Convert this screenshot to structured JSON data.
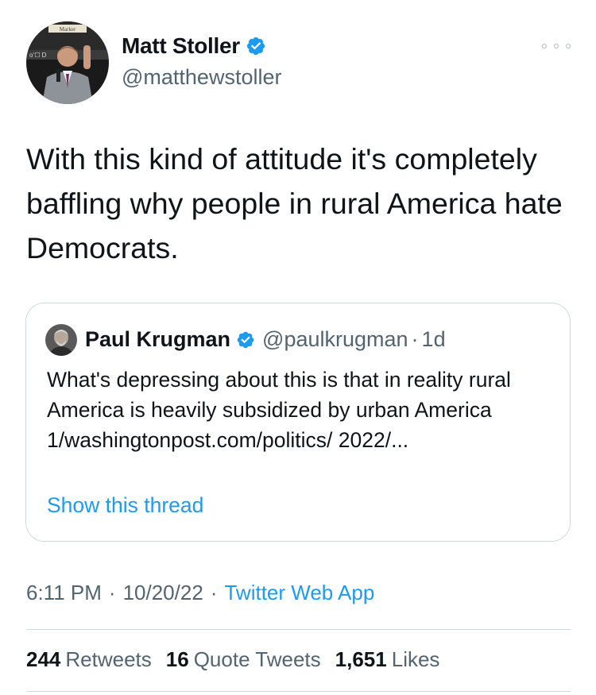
{
  "author": {
    "name": "Matt Stoller",
    "handle": "@matthewstoller",
    "verified": true,
    "avatar_sign_text": "Marker"
  },
  "tweet": {
    "text": "With this kind of attitude it's completely baffling why people in rural America hate Democrats."
  },
  "quote": {
    "name": "Paul Krugman",
    "handle": "@paulkrugman",
    "dot": "·",
    "time": "1d",
    "text": "What's depressing about this is that in reality rural America is heavily subsidized by urban America 1/washingtonpost.com/politics/ 2022/...",
    "show_thread": "Show this thread"
  },
  "meta": {
    "time": "6:11 PM",
    "sep1": "·",
    "date": "10/20/22",
    "sep2": "·",
    "app": "Twitter Web App"
  },
  "stats": [
    {
      "count": "244",
      "label": "Retweets"
    },
    {
      "count": "16",
      "label": "Quote Tweets"
    },
    {
      "count": "1,651",
      "label": "Likes"
    }
  ],
  "colors": {
    "accent": "#1d9bf0",
    "secondary_text": "#536471",
    "border": "#cfd9de"
  }
}
